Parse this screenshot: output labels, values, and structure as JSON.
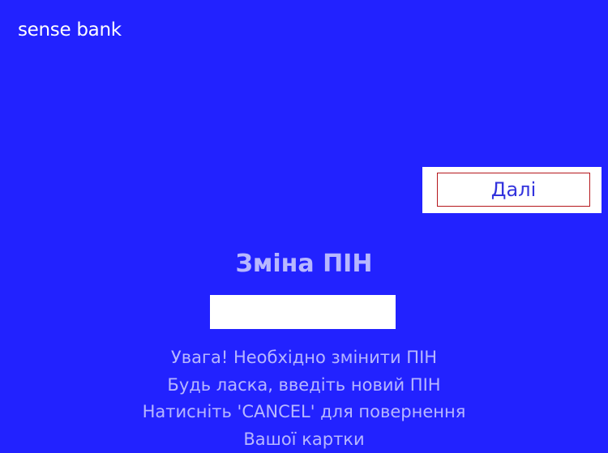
{
  "brand": {
    "logo_text": "sense bank"
  },
  "actions": {
    "next_label": "Далі"
  },
  "screen": {
    "title": "Зміна ПІН",
    "pin_value": "",
    "messages": [
      "Увага! Необхідно змінити ПІН",
      "Будь ласка, введіть новий ПІН",
      "Натисніть 'CANCEL' для повернення",
      "Вашої картки"
    ]
  },
  "colors": {
    "background": "#2222ff",
    "text_muted": "#b7b7ff",
    "button_border": "#b5171c"
  }
}
